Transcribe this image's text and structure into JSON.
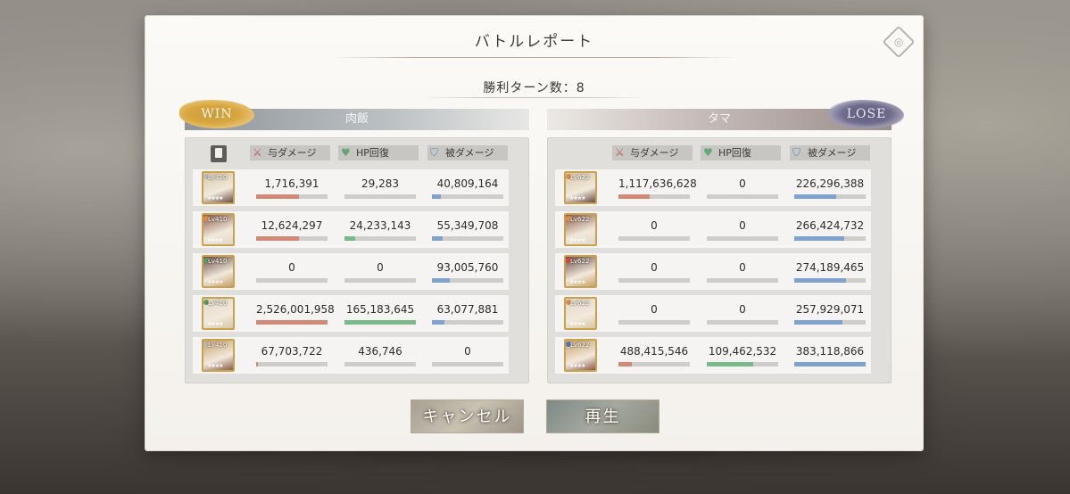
{
  "dialog": {
    "title": "バトルレポート",
    "turns_text": "勝利ターン数：8"
  },
  "headers": {
    "damage": "与ダメージ",
    "hp_recovery": "HP回復",
    "damage_taken": "被ダメージ"
  },
  "icons": {
    "copy": "copy-icon",
    "damage": "sword-icon",
    "hp": "heart-icon",
    "defense": "shield-icon",
    "corner": "emblem-icon"
  },
  "colors": {
    "damage_bar": "#d18a78",
    "hp_bar": "#79b98a",
    "taken_bar": "#7fa2cf",
    "win_badge": "#d9a73f",
    "lose_badge": "#6e6b8c"
  },
  "left_team": {
    "name": "肉飯",
    "result": "WIN",
    "members": [
      {
        "level": "Lv410",
        "orb": "#b8b8b8",
        "damage": "1,716,391",
        "dmg_ratio": 0.6,
        "hp": "29,283",
        "hp_ratio": 0.0,
        "taken": "40,809,164",
        "taken_ratio": 0.12
      },
      {
        "level": "Lv410",
        "orb": "#e2894a",
        "damage": "12,624,297",
        "dmg_ratio": 0.6,
        "hp": "24,233,143",
        "hp_ratio": 0.15,
        "taken": "55,349,708",
        "taken_ratio": 0.15
      },
      {
        "level": "Lv410",
        "orb": "#5a9a5d",
        "damage": "0",
        "dmg_ratio": 0.0,
        "hp": "0",
        "hp_ratio": 0.0,
        "taken": "93,005,760",
        "taken_ratio": 0.25
      },
      {
        "level": "Lv410",
        "orb": "#5a9a5d",
        "damage": "2,526,001,958",
        "dmg_ratio": 1.0,
        "hp": "165,183,645",
        "hp_ratio": 1.0,
        "taken": "63,077,881",
        "taken_ratio": 0.17
      },
      {
        "level": "Lv410",
        "orb": "#b8b8b8",
        "damage": "67,703,722",
        "dmg_ratio": 0.03,
        "hp": "436,746",
        "hp_ratio": 0.0,
        "taken": "0",
        "taken_ratio": 0.0
      }
    ]
  },
  "right_team": {
    "name": "タマ",
    "result": "LOSE",
    "members": [
      {
        "level": "Lv623",
        "orb": "#e2894a",
        "damage": "1,117,636,628",
        "dmg_ratio": 0.44,
        "hp": "0",
        "hp_ratio": 0.0,
        "taken": "226,296,388",
        "taken_ratio": 0.59
      },
      {
        "level": "Lv622",
        "orb": "#e2894a",
        "damage": "0",
        "dmg_ratio": 0.0,
        "hp": "0",
        "hp_ratio": 0.0,
        "taken": "266,424,732",
        "taken_ratio": 0.7
      },
      {
        "level": "Lv622",
        "orb": "#d2473d",
        "damage": "0",
        "dmg_ratio": 0.0,
        "hp": "0",
        "hp_ratio": 0.0,
        "taken": "274,189,465",
        "taken_ratio": 0.72
      },
      {
        "level": "Lv622",
        "orb": "#e2894a",
        "damage": "0",
        "dmg_ratio": 0.0,
        "hp": "0",
        "hp_ratio": 0.0,
        "taken": "257,929,071",
        "taken_ratio": 0.67
      },
      {
        "level": "Lv622",
        "orb": "#4f79c6",
        "damage": "488,415,546",
        "dmg_ratio": 0.19,
        "hp": "109,462,532",
        "hp_ratio": 0.65,
        "taken": "383,118,866",
        "taken_ratio": 1.0
      }
    ]
  },
  "buttons": {
    "cancel": "キャンセル",
    "play": "再生"
  }
}
